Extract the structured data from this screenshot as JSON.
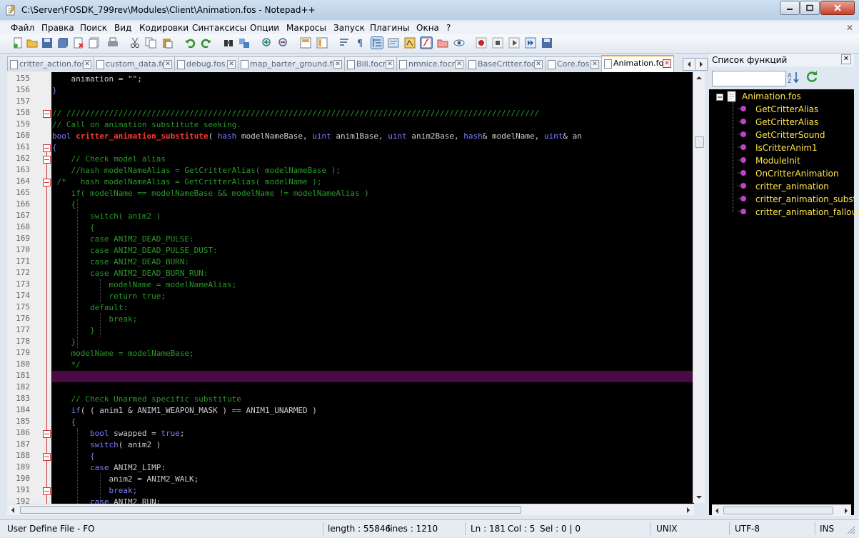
{
  "window": {
    "title": "C:\\Server\\FOSDK_799rev\\Modules\\Client\\Animation.fos - Notepad++"
  },
  "menu": [
    "Файл",
    "Правка",
    "Поиск",
    "Вид",
    "Кодировки",
    "Синтаксисы",
    "Опции",
    "Макросы",
    "Запуск",
    "Плагины",
    "Окна",
    "?"
  ],
  "tabs": [
    {
      "label": "critter_action.fos",
      "active": false
    },
    {
      "label": "custom_data.fos",
      "active": false
    },
    {
      "label": "debug.fos",
      "active": false
    },
    {
      "label": "map_barter_ground.fos",
      "active": false
    },
    {
      "label": "Bill.focr",
      "active": false
    },
    {
      "label": "nmnice.focr",
      "active": false
    },
    {
      "label": "BaseCritter.focr",
      "active": false
    },
    {
      "label": "Core.fos",
      "active": false
    },
    {
      "label": "Animation.fos",
      "active": true
    }
  ],
  "editor": {
    "lines": [
      {
        "n": "155",
        "text": "    animation = \"\";"
      },
      {
        "n": "156",
        "text": "}"
      },
      {
        "n": "157",
        "text": ""
      },
      {
        "n": "158",
        "text": "// ////////////////////////////////////////////////////////////////////////////////////////////////////"
      },
      {
        "n": "159",
        "text": "// Call on animation substitute seeking."
      },
      {
        "n": "160",
        "text": "bool critter_animation_substitute( hash modelNameBase, uint anim1Base, uint anim2Base, hash& modelName, uint& an"
      },
      {
        "n": "161",
        "text": "{"
      },
      {
        "n": "162",
        "text": "    // Check model alias"
      },
      {
        "n": "163",
        "text": "    //hash modelNameAlias = GetCritterAlias( modelNameBase );"
      },
      {
        "n": "164",
        "text": " /*   hash modelNameAlias = GetCritterAlias( modelName );"
      },
      {
        "n": "165",
        "text": "    if( modelName == modelNameBase && modelName != modelNameAlias )"
      },
      {
        "n": "166",
        "text": "    {"
      },
      {
        "n": "167",
        "text": "        switch( anim2 )"
      },
      {
        "n": "168",
        "text": "        {"
      },
      {
        "n": "169",
        "text": "        case ANIM2_DEAD_PULSE:"
      },
      {
        "n": "170",
        "text": "        case ANIM2_DEAD_PULSE_DUST:"
      },
      {
        "n": "171",
        "text": "        case ANIM2_DEAD_BURN:"
      },
      {
        "n": "172",
        "text": "        case ANIM2_DEAD_BURN_RUN:"
      },
      {
        "n": "173",
        "text": "            modelName = modelNameAlias;"
      },
      {
        "n": "174",
        "text": "            return true;"
      },
      {
        "n": "175",
        "text": "        default:"
      },
      {
        "n": "176",
        "text": "            break;"
      },
      {
        "n": "177",
        "text": "        }"
      },
      {
        "n": "178",
        "text": "    }"
      },
      {
        "n": "179",
        "text": "    modelName = modelNameBase;"
      },
      {
        "n": "180",
        "text": "    */"
      },
      {
        "n": "181",
        "text": ""
      },
      {
        "n": "182",
        "text": ""
      },
      {
        "n": "183",
        "text": "    // Check Unarmed specific substitute"
      },
      {
        "n": "184",
        "text": "    if( ( anim1 & ANIM1_WEAPON_MASK ) == ANIM1_UNARMED )"
      },
      {
        "n": "185",
        "text": "    {"
      },
      {
        "n": "186",
        "text": "        bool swapped = true;"
      },
      {
        "n": "187",
        "text": "        switch( anim2 )"
      },
      {
        "n": "188",
        "text": "        {"
      },
      {
        "n": "189",
        "text": "        case ANIM2_LIMP:"
      },
      {
        "n": "190",
        "text": "            anim2 = ANIM2_WALK;"
      },
      {
        "n": "191",
        "text": "            break;"
      },
      {
        "n": "192",
        "text": "        case ANIM2_RUN:"
      }
    ],
    "current_line": "181"
  },
  "function_list": {
    "title": "Список функций",
    "search_value": "",
    "root": "Animation.fos",
    "items": [
      "GetCritterAlias",
      "GetCritterAlias",
      "GetCritterSound",
      "IsCritterAnim1",
      "ModuleInit",
      "OnCritterAnimation",
      "critter_animation",
      "critter_animation_substitu",
      "critter_animation_fallout"
    ]
  },
  "status": {
    "language": "User Define File - FO",
    "length": "length : 55846",
    "lines": "lines : 1210",
    "ln": "Ln : 181",
    "col": "Col : 5",
    "sel": "Sel : 0 | 0",
    "eol": "UNIX",
    "encoding": "UTF-8",
    "mode": "INS"
  },
  "colors": {
    "comment": "#2a9a2a",
    "keyword": "#7d7dff",
    "function": "#ff3b30",
    "current_line": "#4a0b45",
    "function_list_text": "#ffe54a"
  }
}
